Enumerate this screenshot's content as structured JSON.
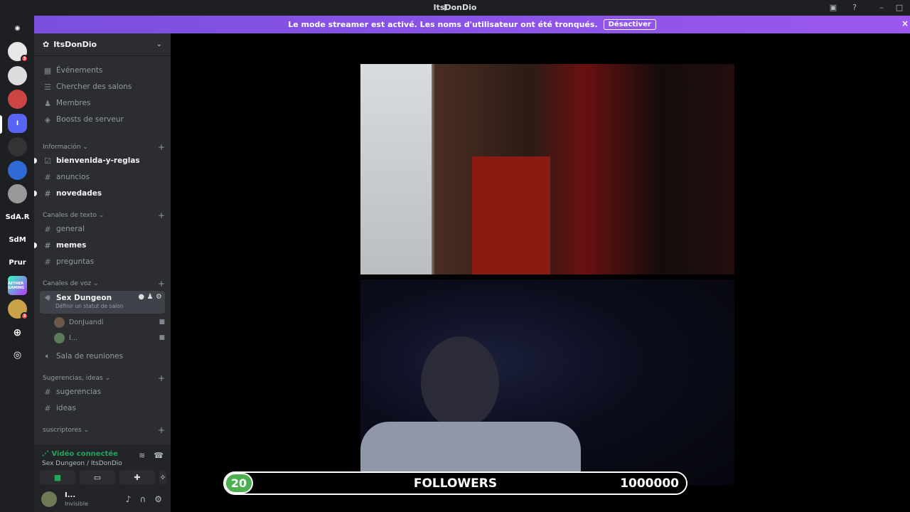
{
  "window": {
    "title": "ItsDonDio"
  },
  "banner": {
    "text": "Le mode streamer est activé. Les noms d'utilisateur ont été tronqués.",
    "button": "Désactiver"
  },
  "guilds": [
    {
      "label": "",
      "badge": "3"
    },
    {
      "label": "",
      "badge": ""
    },
    {
      "label": "",
      "badge": ""
    },
    {
      "label": "I",
      "badge": ""
    },
    {
      "label": "",
      "badge": ""
    },
    {
      "label": "",
      "badge": ""
    },
    {
      "label": "",
      "badge": ""
    },
    {
      "label": "SdA.R",
      "badge": ""
    },
    {
      "label": "SdM",
      "badge": ""
    },
    {
      "label": "Prur",
      "badge": ""
    },
    {
      "label": "AETHER GAMING",
      "badge": ""
    },
    {
      "label": "",
      "badge": "3"
    }
  ],
  "server": {
    "name": "ItsDonDio"
  },
  "menu": {
    "events": "Événements",
    "browse": "Chercher des salons",
    "members": "Membres",
    "boosts": "Boosts de serveur"
  },
  "categories": {
    "info": "Información",
    "text": "Canales de texto",
    "voice": "Canales de voz",
    "suggestions": "Sugerencias, ideas",
    "subs": "suscriptores"
  },
  "channels": {
    "bienvenida": "bienvenida-y-reglas",
    "anuncios": "anuncios",
    "novedades": "novedades",
    "general": "general",
    "memes": "memes",
    "preguntas": "preguntas",
    "voice_active": "Sex Dungeon",
    "voice_status": "Définir un statut de salon",
    "sala": "Sala de reuniones",
    "sugerencias": "sugerencias",
    "ideas": "ideas"
  },
  "voice_members": [
    "DonJuandi",
    "I..."
  ],
  "voice_panel": {
    "status": "Vidéo connectée",
    "location": "Sex Dungeon / ItsDonDio"
  },
  "user": {
    "name": "I...",
    "status": "Invisible"
  },
  "overlay": {
    "count": "20",
    "label": "FOLLOWERS",
    "goal": "1000000"
  },
  "colors": {
    "accent": "#5865f2",
    "banner": "#9b57ee",
    "connected": "#23a55a",
    "counter": "#4caf50"
  }
}
